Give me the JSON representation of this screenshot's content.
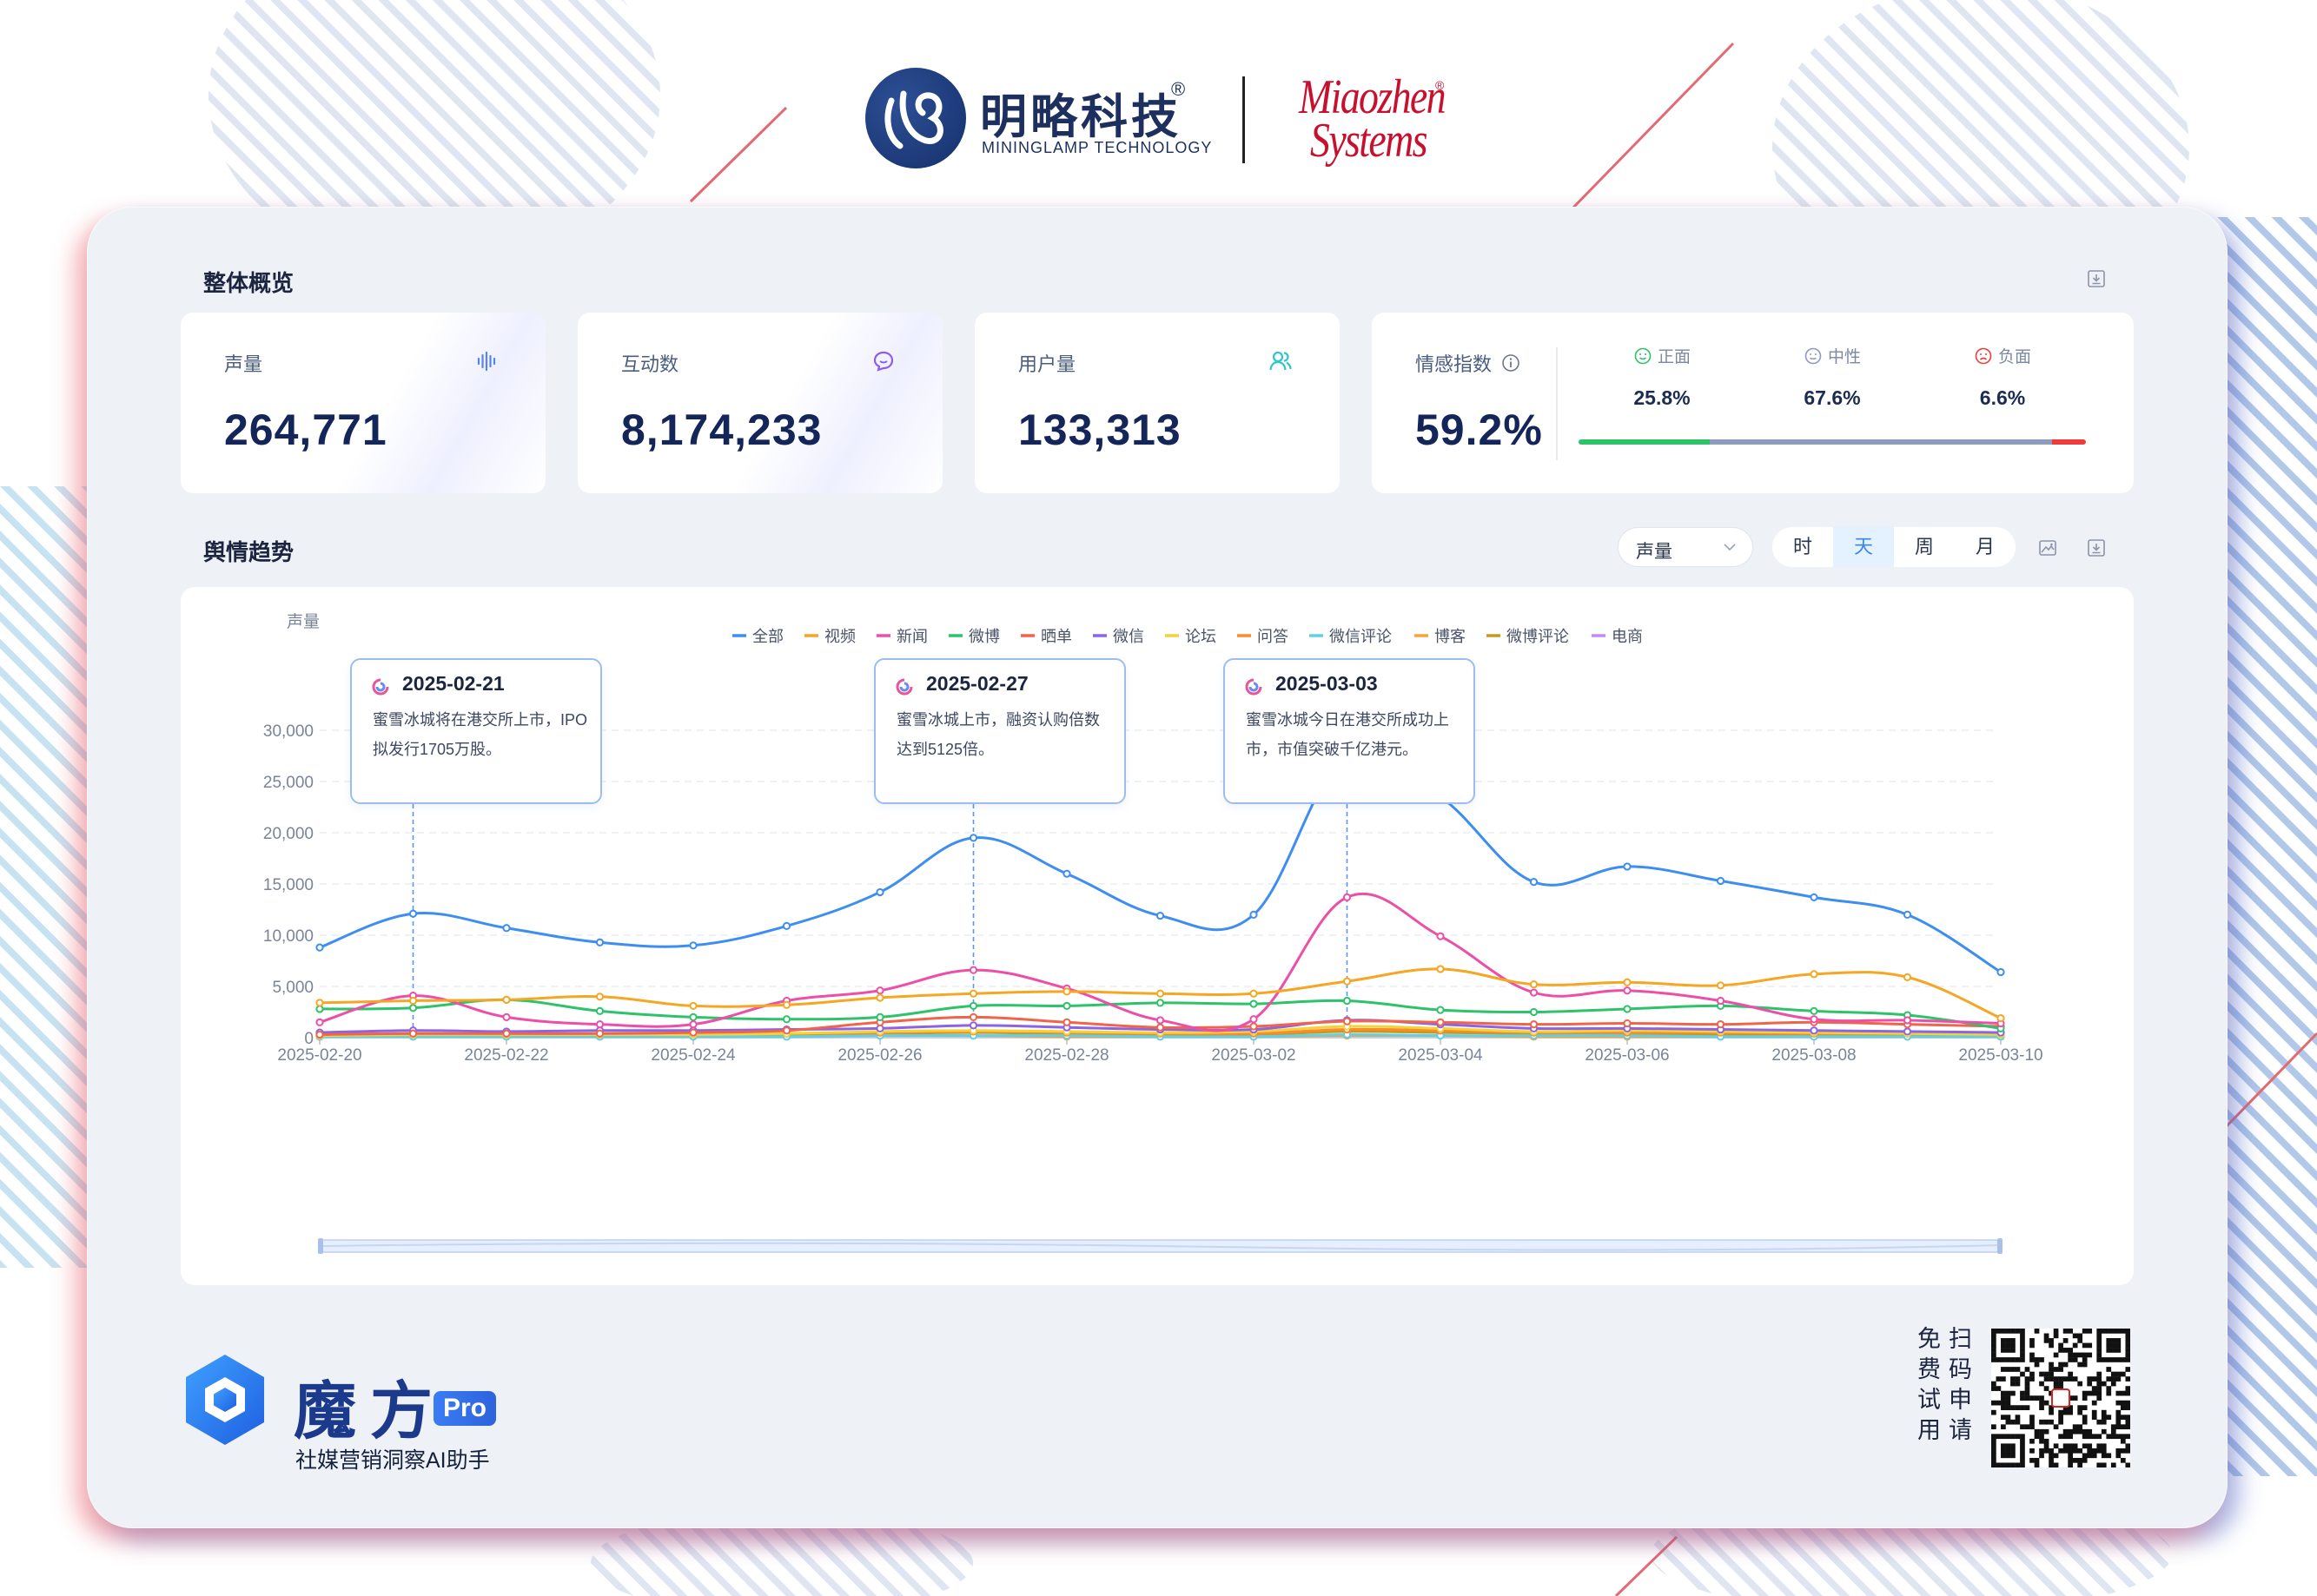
{
  "brand": {
    "miningLampCn": "明略科技",
    "miningLampReg": "®",
    "miningLampEn": "MININGLAMP TECHNOLOGY",
    "miaozhenLine1": "Miaozhen",
    "miaozhenLine2": "Systems",
    "miaozhenReg": "®"
  },
  "overview": {
    "title": "整体概览",
    "cards": [
      {
        "label": "声量",
        "value": "264,771",
        "icon": "waveform-icon"
      },
      {
        "label": "互动数",
        "value": "8,174,233",
        "icon": "chat-icon"
      },
      {
        "label": "用户量",
        "value": "133,313",
        "icon": "users-icon"
      }
    ],
    "sentiment": {
      "label": "情感指数",
      "value": "59.2%",
      "items": [
        {
          "label": "正面",
          "value": "25.8%",
          "fraction": 0.258,
          "color": "#2ec26a",
          "icon": "smile-icon"
        },
        {
          "label": "中性",
          "value": "67.6%",
          "fraction": 0.676,
          "color": "#8d9bbd",
          "icon": "neutral-face-icon"
        },
        {
          "label": "负面",
          "value": "6.6%",
          "fraction": 0.066,
          "color": "#ef3b3b",
          "icon": "sad-face-icon"
        }
      ]
    }
  },
  "trend": {
    "title": "舆情趋势",
    "metricSelect": "声量",
    "granularity": [
      "时",
      "天",
      "周",
      "月"
    ],
    "activeGranularity": "天"
  },
  "chart_data": {
    "type": "line",
    "ylabel": "声量",
    "ylim": [
      0,
      30000
    ],
    "yticks": [
      "0",
      "5,000",
      "10,000",
      "15,000",
      "20,000",
      "25,000",
      "30,000"
    ],
    "x": [
      "2025-02-20",
      "2025-02-21",
      "2025-02-22",
      "2025-02-23",
      "2025-02-24",
      "2025-02-25",
      "2025-02-26",
      "2025-02-27",
      "2025-02-28",
      "2025-03-01",
      "2025-03-02",
      "2025-03-03",
      "2025-03-04",
      "2025-03-05",
      "2025-03-06",
      "2025-03-07",
      "2025-03-08",
      "2025-03-09",
      "2025-03-10"
    ],
    "xticks": [
      "2025-02-20",
      "2025-02-22",
      "2025-02-24",
      "2025-02-26",
      "2025-02-28",
      "2025-03-02",
      "2025-03-04",
      "2025-03-06",
      "2025-03-08",
      "2025-03-10"
    ],
    "legend_position": "top",
    "grid": true,
    "series": [
      {
        "name": "全部",
        "color": "#3d8ef0",
        "values": [
          8800,
          12100,
          10700,
          9300,
          9000,
          10900,
          14200,
          19500,
          16000,
          11900,
          12000,
          27700,
          23500,
          15200,
          16700,
          15300,
          13700,
          12000,
          6400
        ]
      },
      {
        "name": "视频",
        "color": "#f5a623",
        "values": [
          3400,
          3600,
          3700,
          4000,
          3100,
          3200,
          3900,
          4300,
          4500,
          4300,
          4300,
          5500,
          6700,
          5200,
          5400,
          5100,
          6200,
          5900,
          1900
        ]
      },
      {
        "name": "新闻",
        "color": "#ec4fa8",
        "values": [
          1500,
          4100,
          2000,
          1300,
          1300,
          3600,
          4600,
          6600,
          4800,
          1700,
          1800,
          13700,
          9900,
          4400,
          4600,
          3600,
          1800,
          1700,
          1400
        ]
      },
      {
        "name": "微博",
        "color": "#2ec26a",
        "values": [
          2800,
          2900,
          3700,
          2600,
          2000,
          1800,
          2000,
          3100,
          3100,
          3400,
          3300,
          3600,
          2700,
          2500,
          2800,
          3100,
          2600,
          2200,
          900
        ]
      },
      {
        "name": "晒单",
        "color": "#f0644b",
        "values": [
          300,
          400,
          400,
          400,
          500,
          700,
          1500,
          2000,
          1500,
          1000,
          1100,
          1600,
          1500,
          1300,
          1400,
          1300,
          1500,
          1300,
          1100
        ]
      },
      {
        "name": "微信",
        "color": "#8a63e8",
        "values": [
          500,
          700,
          600,
          700,
          700,
          800,
          900,
          1200,
          1000,
          800,
          800,
          1700,
          1300,
          900,
          900,
          800,
          700,
          600,
          500
        ]
      },
      {
        "name": "论坛",
        "color": "#f2d33a",
        "values": [
          200,
          300,
          300,
          300,
          300,
          400,
          600,
          700,
          600,
          500,
          600,
          1100,
          900,
          600,
          700,
          600,
          500,
          400,
          300
        ]
      },
      {
        "name": "问答",
        "color": "#ff8a2a",
        "values": [
          300,
          400,
          300,
          300,
          400,
          400,
          500,
          600,
          500,
          400,
          400,
          800,
          700,
          500,
          500,
          500,
          400,
          400,
          300
        ]
      },
      {
        "name": "微信评论",
        "color": "#5fd0e8",
        "values": [
          100,
          100,
          100,
          100,
          100,
          100,
          200,
          200,
          200,
          100,
          100,
          300,
          200,
          200,
          200,
          100,
          100,
          100,
          100
        ]
      },
      {
        "name": "博客",
        "color": "#f7a43b",
        "values": [
          100,
          100,
          100,
          100,
          100,
          100,
          200,
          200,
          100,
          100,
          100,
          200,
          200,
          100,
          100,
          100,
          100,
          100,
          100
        ]
      },
      {
        "name": "微博评论",
        "color": "#c49a1e",
        "values": [
          100,
          200,
          200,
          200,
          200,
          300,
          400,
          500,
          400,
          300,
          300,
          600,
          500,
          400,
          400,
          300,
          300,
          300,
          200
        ]
      },
      {
        "name": "电商",
        "color": "#c58af0",
        "values": [
          200,
          300,
          300,
          300,
          300,
          400,
          500,
          600,
          500,
          400,
          500,
          700,
          600,
          500,
          500,
          400,
          400,
          300,
          300
        ]
      }
    ],
    "annotations": [
      {
        "x": "2025-02-21",
        "date": "2025-02-21",
        "text": "蜜雪冰城将在港交所上市，IPO拟发行1705万股。"
      },
      {
        "x": "2025-02-27",
        "date": "2025-02-27",
        "text": "蜜雪冰城上市，融资认购倍数达到5125倍。"
      },
      {
        "x": "2025-03-03",
        "date": "2025-03-03",
        "text": "蜜雪冰城今日在港交所成功上市，市值突破千亿港元。"
      }
    ]
  },
  "footer": {
    "productName": "魔方",
    "productTier": "Pro",
    "tagline": "社媒营销洞察AI助手",
    "trialColumns": [
      "扫码申请",
      "免费试用"
    ]
  }
}
